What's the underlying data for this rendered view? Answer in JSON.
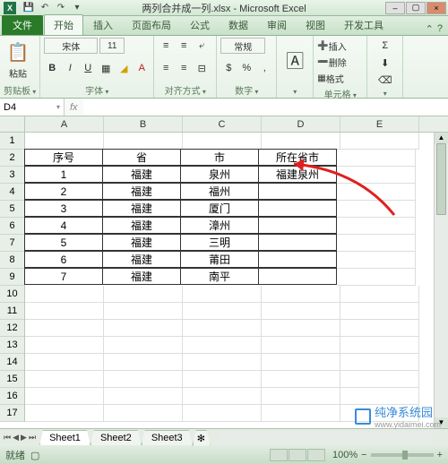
{
  "titlebar": {
    "filename": "两列合并成一列.xlsx - Microsoft Excel",
    "qat": [
      "save",
      "undo",
      "redo"
    ]
  },
  "tabs": {
    "file": "文件",
    "items": [
      "开始",
      "插入",
      "页面布局",
      "公式",
      "数据",
      "审阅",
      "视图",
      "开发工具"
    ],
    "active": 0
  },
  "ribbon": {
    "clipboard": {
      "label": "剪贴板",
      "paste": "粘贴"
    },
    "font": {
      "label": "字体",
      "family": "宋体",
      "size": "11"
    },
    "alignment": {
      "label": "对齐方式"
    },
    "number": {
      "label": "数字",
      "format": "常规"
    },
    "cells": {
      "label": "单元格",
      "insert": "插入",
      "delete": "删除",
      "format": "格式"
    }
  },
  "formula_bar": {
    "name_box": "D4",
    "formula": ""
  },
  "columns": [
    "A",
    "B",
    "C",
    "D",
    "E"
  ],
  "row_count": 17,
  "table": {
    "headers": [
      "序号",
      "省",
      "市",
      "所在省市"
    ],
    "rows": [
      [
        "1",
        "福建",
        "泉州",
        "福建泉州"
      ],
      [
        "2",
        "福建",
        "福州",
        ""
      ],
      [
        "3",
        "福建",
        "厦门",
        ""
      ],
      [
        "4",
        "福建",
        "漳州",
        ""
      ],
      [
        "5",
        "福建",
        "三明",
        ""
      ],
      [
        "6",
        "福建",
        "莆田",
        ""
      ],
      [
        "7",
        "福建",
        "南平",
        ""
      ]
    ]
  },
  "sheets": {
    "items": [
      "Sheet1",
      "Sheet2",
      "Sheet3"
    ],
    "active": 0
  },
  "statusbar": {
    "ready": "就绪",
    "zoom": "100%"
  },
  "watermark": {
    "text": "纯净系统园",
    "url": "www.yidaimei.com"
  }
}
